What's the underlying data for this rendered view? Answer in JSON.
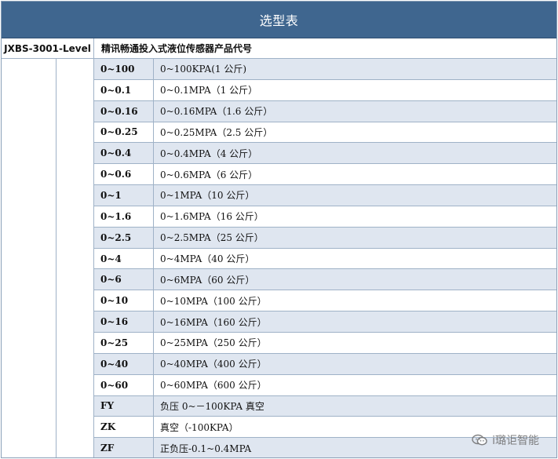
{
  "table": {
    "title": "选型表",
    "header_left": "JXBS-3001-Level",
    "header_right": "精讯畅通投入式液位传感器产品代号",
    "rows": [
      {
        "code": "0~100",
        "desc": "0~100KPA(1 公斤)",
        "shaded": true
      },
      {
        "code": "0~0.1",
        "desc": "0~0.1MPA（1 公斤）",
        "shaded": false
      },
      {
        "code": "0~0.16",
        "desc": "0~0.16MPA（1.6 公斤）",
        "shaded": true
      },
      {
        "code": "0~0.25",
        "desc": "0~0.25MPA（2.5 公斤）",
        "shaded": false
      },
      {
        "code": "0~0.4",
        "desc": "0~0.4MPA（4 公斤）",
        "shaded": true
      },
      {
        "code": "0~0.6",
        "desc": "0~0.6MPA（6 公斤）",
        "shaded": false
      },
      {
        "code": "0~1",
        "desc": "0~1MPA（10 公斤）",
        "shaded": true
      },
      {
        "code": "0~1.6",
        "desc": "0~1.6MPA（16 公斤）",
        "shaded": false
      },
      {
        "code": "0~2.5",
        "desc": "0~2.5MPA（25 公斤）",
        "shaded": true
      },
      {
        "code": "0~4",
        "desc": "0~4MPA（40 公斤）",
        "shaded": false
      },
      {
        "code": "0~6",
        "desc": "0~6MPA（60 公斤）",
        "shaded": true
      },
      {
        "code": "0~10",
        "desc": "0~10MPA（100 公斤）",
        "shaded": false
      },
      {
        "code": "0~16",
        "desc": "0~16MPA（160 公斤）",
        "shaded": true
      },
      {
        "code": "0~25",
        "desc": "0~25MPA（250 公斤）",
        "shaded": false
      },
      {
        "code": "0~40",
        "desc": "0~40MPA（400 公斤）",
        "shaded": true
      },
      {
        "code": "0~60",
        "desc": "0~60MPA（600 公斤）",
        "shaded": false
      },
      {
        "code": "FY",
        "desc": "负压 0~－100KPA 真空",
        "shaded": true
      },
      {
        "code": "ZK",
        "desc": "真空（-100KPA）",
        "shaded": false
      },
      {
        "code": "ZF",
        "desc": "正负压-0.1~0.4MPA",
        "shaded": true
      }
    ]
  },
  "watermark": {
    "text": "i璐讵智能",
    "icon": "wechat-icon"
  }
}
